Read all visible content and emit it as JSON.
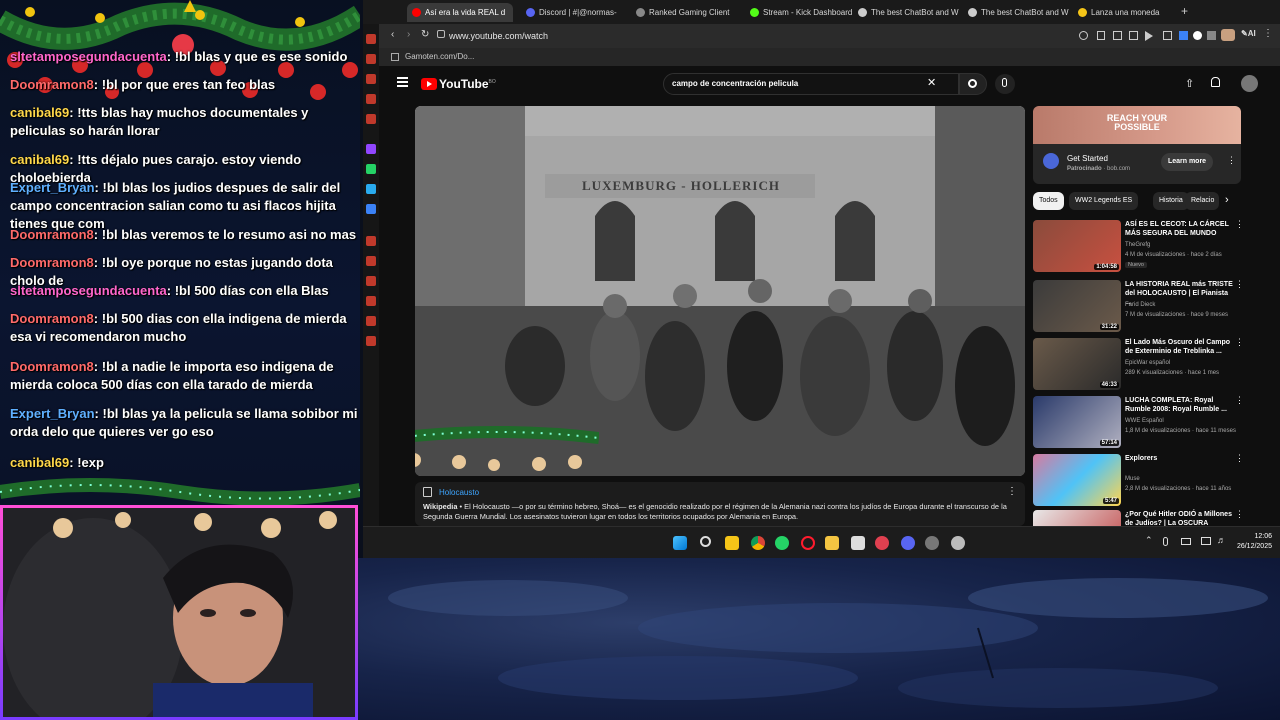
{
  "chat": {
    "messages": [
      {
        "user": "sltetamposegundacuenta",
        "text": "!bl blas y que es ese sonido"
      },
      {
        "user": "Doomramon8",
        "text": "!bl por que eres tan feo blas"
      },
      {
        "user": "canibal69",
        "text": "!tts blas hay muchos documentales y peliculas so harán llorar"
      },
      {
        "user": "canibal69",
        "text": "!tts déjalo pues carajo. estoy viendo choloebierda"
      },
      {
        "user": "Expert_Bryan",
        "text": "!bl blas los judios despues de salir del campo concentracion salian como tu asi flacos hijita tienes que com"
      },
      {
        "user": "Doomramon8",
        "text": "!bl blas veremos te lo resumo asi no mas"
      },
      {
        "user": "Doomramon8",
        "text": "!bl oye porque no estas jugando dota cholo de"
      },
      {
        "user": "sltetamposegundacuenta",
        "text": "!bl 500 días con ella Blas"
      },
      {
        "user": "Doomramon8",
        "text": "!bl 500 dias con ella indigena de mierda esa vi recomendaron mucho"
      },
      {
        "user": "Doomramon8",
        "text": "!bl a nadie le importa eso indigena de mierda coloca 500 días con ella tarado de mierda"
      },
      {
        "user": "Expert_Bryan",
        "text": "!bl blas ya la pelicula se llama sobibor mi orda delo que quieres ver go eso"
      },
      {
        "user": "canibal69",
        "text": "!exp"
      }
    ]
  },
  "browser": {
    "tabs": [
      {
        "label": "Así era la vida REAL d",
        "color": "#ff0000",
        "active": true
      },
      {
        "label": "Discord | #|@normas-",
        "color": "#5865f2",
        "active": false
      },
      {
        "label": "Ranked Gaming Client",
        "color": "#888888",
        "active": false
      },
      {
        "label": "Stream - Kick Dashboard",
        "color": "#53fc18",
        "active": false
      },
      {
        "label": "The best ChatBot and W",
        "color": "#cccccc",
        "active": false
      },
      {
        "label": "The best ChatBot and W",
        "color": "#cccccc",
        "active": false
      },
      {
        "label": "Lanza una moneda",
        "color": "#f5c518",
        "active": false
      }
    ],
    "url": "www.youtube.com/watch",
    "bookmark": "Gamoten.com/Do..."
  },
  "youtube": {
    "logo": "YouTube",
    "logo_country": "BO",
    "search_query": "campo de concentración pelicula",
    "video_sign": "LUXEMBURG - HOLLERICH",
    "wiki": {
      "title": "Holocausto",
      "source": "Wikipedia",
      "text": "El Holocausto —o por su término hebreo, Shoá— es el genocidio realizado por el régimen de la Alemania nazi contra los judíos de Europa durante el transcurso de la Segunda Guerra Mundial. Los asesinatos tuvieron lugar en todos los territorios ocupados por Alemania en Europa."
    },
    "ad": {
      "headline": "REACH YOUR POSSIBLE",
      "title": "Get Started",
      "sponsored": "Patrocinado",
      "domain": "bob.com",
      "button": "Learn more"
    },
    "chips": [
      "Todos",
      "WW2 Legends ES",
      "Historia",
      "Relacio"
    ],
    "recommendations": [
      {
        "title": "ASÍ ES EL CECOT: LA CÁRCEL MÁS SEGURA DEL MUNDO",
        "channel": "TheGrefg",
        "meta": "4 M de visualizaciones · hace 2 días",
        "badge": "Nuevo",
        "duration": "1:04:58",
        "thumb": "#8a4b3c"
      },
      {
        "title": "LA HISTORIA REAL más TRISTE del HOLOCAUSTO | El Pianista ...",
        "channel": "Farid Dieck",
        "meta": "7 M de visualizaciones · hace 9 meses",
        "badge": "",
        "duration": "31:22",
        "thumb": "#3b3b3b"
      },
      {
        "title": "El Lado Más Oscuro del Campo de Exterminio de Treblinka ...",
        "channel": "EpicWar español",
        "meta": "289 K visualizaciones · hace 1 mes",
        "badge": "",
        "duration": "46:33",
        "thumb": "#6a5a4a"
      },
      {
        "title": "LUCHA COMPLETA: Royal Rumble 2008: Royal Rumble ...",
        "channel": "WWE Español",
        "meta": "1,8 M de visualizaciones · hace 11 meses",
        "badge": "",
        "duration": "57:14",
        "thumb": "#2a3a6a"
      },
      {
        "title": "Explorers",
        "channel": "Muse",
        "meta": "2,8 M de visualizaciones · hace 11 años",
        "badge": "",
        "duration": "5:47",
        "thumb": "#d77aa0"
      },
      {
        "title": "¿Por Qué Hitler ODIÓ a Millones de Judíos? | La OSCURA Verdad",
        "channel": "",
        "meta": "",
        "badge": "",
        "duration": "",
        "thumb": "#e8e8e8"
      }
    ]
  },
  "taskbar": {
    "time": "12:06",
    "date": "26/12/2025"
  }
}
